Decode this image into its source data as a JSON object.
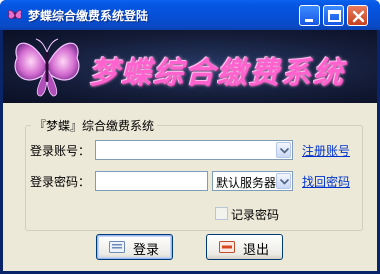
{
  "window": {
    "title": "梦蝶综合缴费系统登陆",
    "icon": "butterfly-icon",
    "controls": [
      "minimize-icon",
      "maximize-icon",
      "close-icon"
    ]
  },
  "banner": {
    "text": "梦蝶综合缴费系统",
    "logo": "butterfly-logo"
  },
  "form": {
    "group_title": "『梦蝶』综合缴费系统",
    "account_label": "登录账号：",
    "account_value": "",
    "password_label": "登录密码：",
    "password_value": "",
    "server_selected": "默认服务器",
    "register_link": "注册账号",
    "recover_link": "找回密码",
    "remember_label": "记录密码",
    "remember_checked": false
  },
  "buttons": {
    "login": "登录",
    "exit": "退出"
  },
  "colors": {
    "title_bar": "#0758e6",
    "banner_text": "#ff62cf",
    "frame": "#ece9d8",
    "link": "#0033cc"
  }
}
